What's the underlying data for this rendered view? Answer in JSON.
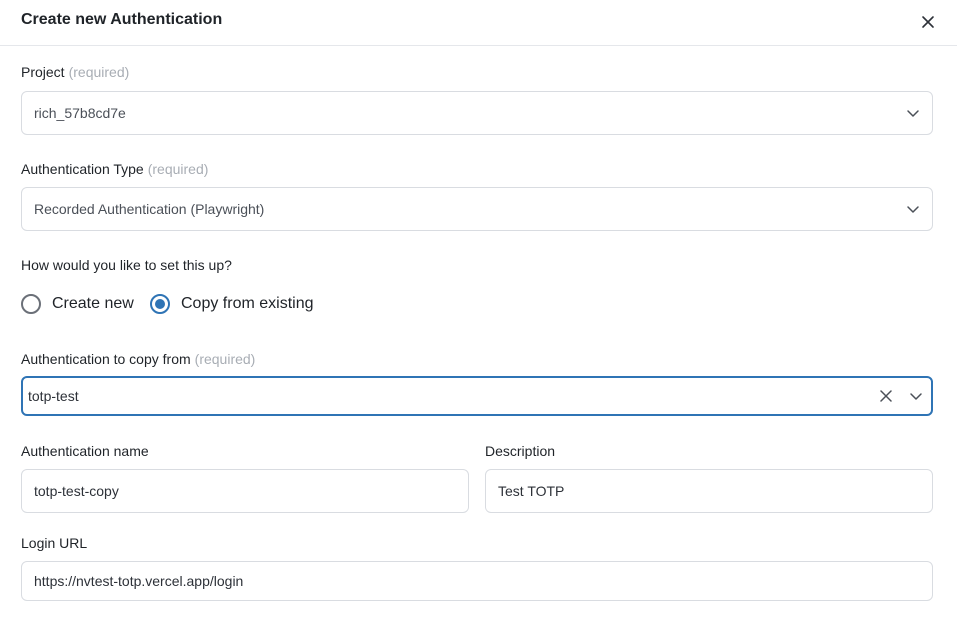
{
  "dialog": {
    "title": "Create new Authentication"
  },
  "project": {
    "label": "Project",
    "required": "(required)",
    "value": "rich_57b8cd7e"
  },
  "auth_type": {
    "label": "Authentication Type",
    "required": "(required)",
    "value": "Recorded Authentication (Playwright)"
  },
  "setup": {
    "question": "How would you like to set this up?",
    "options": [
      {
        "label": "Create new",
        "checked": false
      },
      {
        "label": "Copy from existing",
        "checked": true
      }
    ]
  },
  "copy_from": {
    "label": "Authentication to copy from",
    "required": "(required)",
    "value": "totp-test"
  },
  "auth_name": {
    "label": "Authentication name",
    "value": "totp-test-copy"
  },
  "description": {
    "label": "Description",
    "value": "Test TOTP"
  },
  "login_url": {
    "label": "Login URL",
    "value": "https://nvtest-totp.vercel.app/login"
  },
  "colors": {
    "accent": "#2f74b5",
    "border": "#d9dce1",
    "muted": "#a8adb4"
  },
  "icons": {
    "close": "close-icon",
    "dropdown": "chevron-down-icon",
    "clear": "clear-x-icon"
  }
}
